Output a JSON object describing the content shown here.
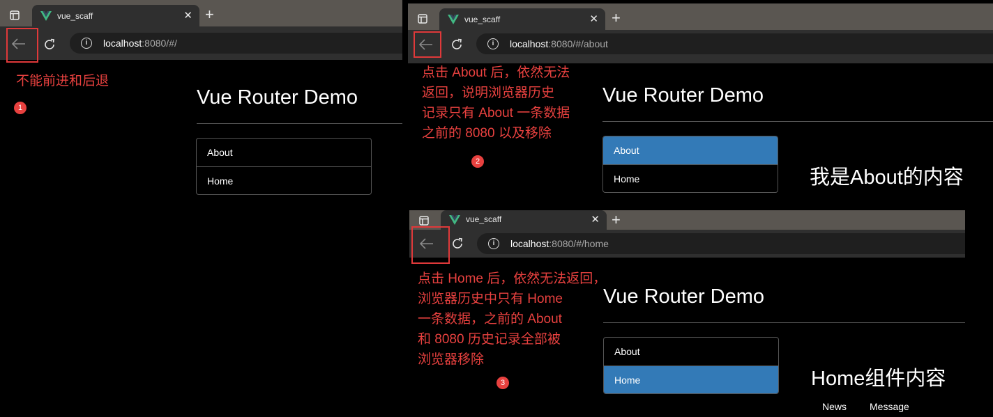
{
  "browsers": [
    {
      "tab_title": "vue_scaff",
      "url_host": "localhost",
      "url_rest": ":8080/#/"
    },
    {
      "tab_title": "vue_scaff",
      "url_host": "localhost",
      "url_rest": ":8080/#/about"
    },
    {
      "tab_title": "vue_scaff",
      "url_host": "localhost",
      "url_rest": ":8080/#/home"
    }
  ],
  "app": {
    "title": "Vue Router Demo",
    "nav": [
      "About",
      "Home"
    ]
  },
  "panel1": {
    "note": "不能前进和后退",
    "badge": "1"
  },
  "panel2": {
    "note_lines": [
      "点击 About 后，依然无法",
      "返回，说明浏览器历史",
      "记录只有 About 一条数据",
      "之前的 8080 以及移除"
    ],
    "badge": "2",
    "content": "我是About的内容"
  },
  "panel3": {
    "note_lines": [
      "点击 Home 后，依然无法返回，",
      "浏览器历史中只有 Home",
      "一条数据，之前的 About",
      "和 8080 历史记录全部被",
      "浏览器移除"
    ],
    "badge": "3",
    "content": "Home组件内容",
    "subnav": [
      "News",
      "Message"
    ]
  },
  "colors": {
    "annotation": "#e8413f",
    "active": "#337ab7"
  }
}
